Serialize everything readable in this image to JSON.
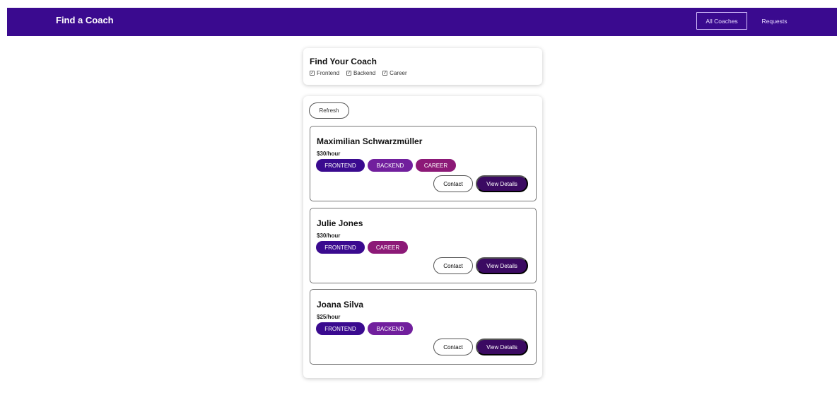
{
  "header": {
    "brand": "Find a Coach",
    "nav": [
      "All Coaches",
      "Requests"
    ]
  },
  "filter": {
    "title": "Find Your Coach",
    "options": [
      "Frontend",
      "Backend",
      "Career"
    ]
  },
  "actions": {
    "refresh": "Refresh",
    "contact": "Contact",
    "view_details": "View Details"
  },
  "coaches": [
    {
      "name": "Maximilian Schwarzmüller",
      "rate": "$30/hour",
      "areas": [
        "FRONTEND",
        "BACKEND",
        "CAREER"
      ]
    },
    {
      "name": "Julie Jones",
      "rate": "$30/hour",
      "areas": [
        "FRONTEND",
        "CAREER"
      ]
    },
    {
      "name": "Joana Silva",
      "rate": "$25/hour",
      "areas": [
        "FRONTEND",
        "BACKEND"
      ]
    }
  ],
  "colors": {
    "header": "#3a0a8f",
    "frontend": "#3a0a8f",
    "backend": "#711f9d",
    "career": "#8c1977",
    "details_button": "#3b0a62"
  }
}
